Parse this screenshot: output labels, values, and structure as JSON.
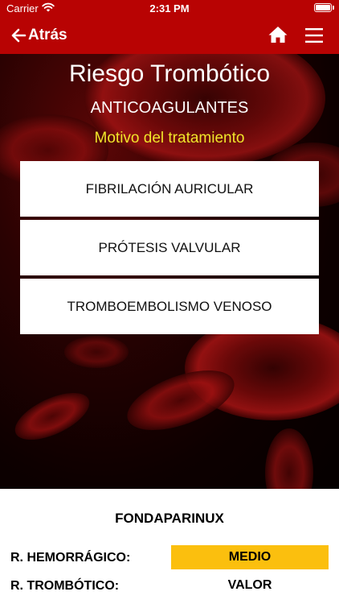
{
  "status_bar": {
    "carrier": "Carrier",
    "time": "2:31 PM"
  },
  "nav": {
    "back_label": "Atrás"
  },
  "hero": {
    "title": "Riesgo Trombótico",
    "subtitle": "ANTICOAGULANTES",
    "section_label": "Motivo del tratamiento"
  },
  "options": [
    {
      "label": "FIBRILACIÓN AURICULAR"
    },
    {
      "label": "PRÓTESIS VALVULAR"
    },
    {
      "label": "TROMBOEMBOLISMO VENOSO"
    }
  ],
  "result": {
    "drug": "FONDAPARINUX",
    "hemorragico_label": "R. HEMORRÁGICO:",
    "hemorragico_value": "MEDIO",
    "trombotico_label": "R. TROMBÓTICO:",
    "trombotico_value": "VALOR"
  },
  "colors": {
    "brand_red": "#b80303",
    "motivo_yellow": "#f0e52a",
    "medio_badge": "#fbbf0e"
  }
}
